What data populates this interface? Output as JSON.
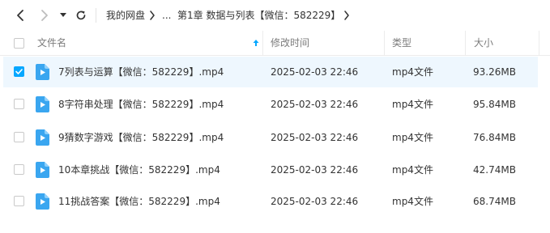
{
  "toolbar": {
    "back_icon": "chevron-left-icon",
    "forward_icon": "chevron-right-icon",
    "history_icon": "caret-down-icon",
    "refresh_icon": "refresh-icon",
    "breadcrumb": {
      "root": "我的网盘",
      "ellipsis": "...",
      "current": "第1章 数据与列表【微信：582229】"
    }
  },
  "table": {
    "headers": {
      "name": "文件名",
      "modified": "修改时间",
      "type": "类型",
      "size": "大小"
    },
    "sort_icon": "sort-up-arrow-icon",
    "rows": [
      {
        "name": "7列表与运算【微信：582229】.mp4",
        "modified": "2025-02-03 22:46",
        "type": "mp4文件",
        "size": "93.26MB",
        "selected": true
      },
      {
        "name": "8字符串处理【微信：582229】.mp4",
        "modified": "2025-02-03 22:46",
        "type": "mp4文件",
        "size": "95.84MB",
        "selected": false
      },
      {
        "name": "9猜数字游戏【微信：582229】.mp4",
        "modified": "2025-02-03 22:46",
        "type": "mp4文件",
        "size": "76.84MB",
        "selected": false
      },
      {
        "name": "10本章挑战【微信：582229】.mp4",
        "modified": "2025-02-03 22:46",
        "type": "mp4文件",
        "size": "42.74MB",
        "selected": false
      },
      {
        "name": "11挑战答案【微信：582229】.mp4",
        "modified": "2025-02-03 22:46",
        "type": "mp4文件",
        "size": "68.74MB",
        "selected": false
      }
    ]
  },
  "colors": {
    "accent": "#06a7ff",
    "selected_row": "#eef7fe",
    "header_text": "#7c7c7c"
  }
}
